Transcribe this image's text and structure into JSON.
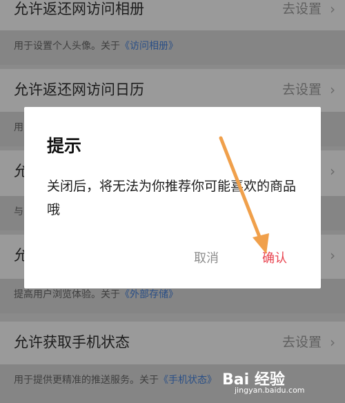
{
  "settings": [
    {
      "title": "允许返还网访问相册",
      "action": "去设置",
      "desc_prefix": "用于设置个人头像。关于",
      "desc_link": "《访问相册》"
    },
    {
      "title": "允许返还网访问日历",
      "action": "去设置",
      "desc_prefix": "用",
      "desc_link": ""
    },
    {
      "title": "允",
      "action": "",
      "desc_prefix": "与",
      "desc_link": ""
    },
    {
      "title": "允",
      "action": "",
      "desc_prefix": "提高用户浏览体验。关于",
      "desc_link": "《外部存储》"
    },
    {
      "title": "允许获取手机状态",
      "action": "去设置",
      "desc_prefix": "用于提供更精准的推送服务。关于",
      "desc_link": "《手机状态》"
    }
  ],
  "dialog": {
    "title": "提示",
    "message": "关闭后，将无法为你推荐你可能喜欢的商品哦",
    "cancel": "取消",
    "confirm": "确认"
  },
  "watermark": {
    "logo": "Bai 经验",
    "url": "jingyan.baidu.com"
  },
  "colors": {
    "confirm": "#e8434f",
    "arrow": "#f0a04b",
    "link": "#2a4f86"
  }
}
